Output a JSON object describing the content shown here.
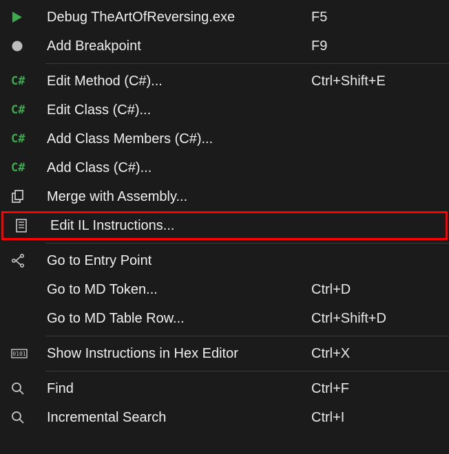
{
  "menu": {
    "items": [
      {
        "label": "Debug TheArtOfReversing.exe",
        "shortcut": "F5"
      },
      {
        "label": "Add Breakpoint",
        "shortcut": "F9"
      },
      {
        "label": "Edit Method (C#)...",
        "shortcut": "Ctrl+Shift+E"
      },
      {
        "label": "Edit Class (C#)...",
        "shortcut": ""
      },
      {
        "label": "Add Class Members (C#)...",
        "shortcut": ""
      },
      {
        "label": "Add Class (C#)...",
        "shortcut": ""
      },
      {
        "label": "Merge with Assembly...",
        "shortcut": ""
      },
      {
        "label": "Edit IL Instructions...",
        "shortcut": ""
      },
      {
        "label": "Go to Entry Point",
        "shortcut": ""
      },
      {
        "label": "Go to MD Token...",
        "shortcut": "Ctrl+D"
      },
      {
        "label": "Go to MD Table Row...",
        "shortcut": "Ctrl+Shift+D"
      },
      {
        "label": "Show Instructions in Hex Editor",
        "shortcut": "Ctrl+X"
      },
      {
        "label": "Find",
        "shortcut": "Ctrl+F"
      },
      {
        "label": "Incremental Search",
        "shortcut": "Ctrl+I"
      }
    ],
    "cs_icon_text": "C#"
  }
}
